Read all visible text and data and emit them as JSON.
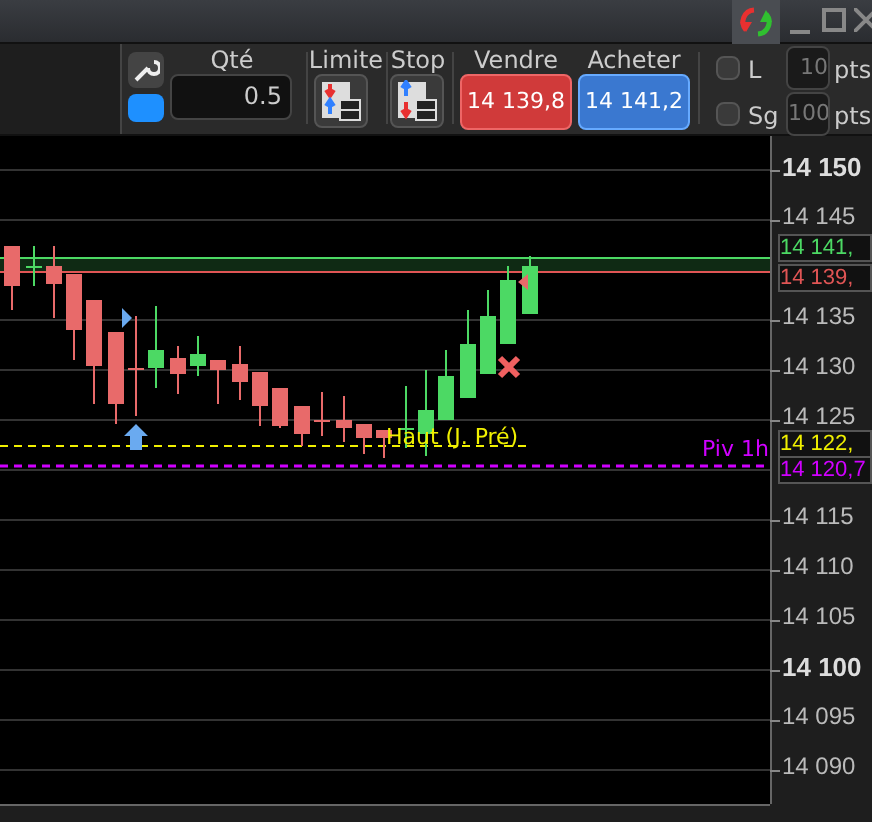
{
  "toolbar": {
    "quantity": {
      "label": "Qté",
      "value": "0.5"
    },
    "limit": {
      "label": "Limite"
    },
    "stop": {
      "label": "Stop"
    },
    "sell": {
      "label": "Vendre",
      "price": "14 139,8"
    },
    "buy": {
      "label": "Acheter",
      "price": "14 141,2"
    },
    "options": [
      {
        "label": "L",
        "checked": false,
        "value": "10",
        "unit": "pts"
      },
      {
        "label": "Sg",
        "checked": false,
        "value": "100",
        "unit": "pts"
      }
    ]
  },
  "chart": {
    "price_axis": [
      {
        "text": "14 150",
        "emphasized": true
      },
      {
        "text": "14 145",
        "emphasized": false
      },
      {
        "text": "14 135",
        "emphasized": false
      },
      {
        "text": "14 130",
        "emphasized": false
      },
      {
        "text": "14 125",
        "emphasized": false
      },
      {
        "text": "14 115",
        "emphasized": false
      },
      {
        "text": "14 110",
        "emphasized": false
      },
      {
        "text": "14 105",
        "emphasized": false
      },
      {
        "text": "14 100",
        "emphasized": true
      },
      {
        "text": "14 095",
        "emphasized": false
      },
      {
        "text": "14 090",
        "emphasized": false
      }
    ],
    "price_tags": [
      {
        "text": "14 141,",
        "color": "#4cd964"
      },
      {
        "text": "14 139,",
        "color": "#e05555"
      },
      {
        "text": "14 122,",
        "color": "#f0f000"
      },
      {
        "text": "14 120,7",
        "color": "#d000ff"
      }
    ],
    "level_labels": [
      {
        "text": "Haut (J. Pré)",
        "color": "#f0f000"
      },
      {
        "text": "Piv 1h",
        "color": "#d000ff"
      }
    ]
  }
}
